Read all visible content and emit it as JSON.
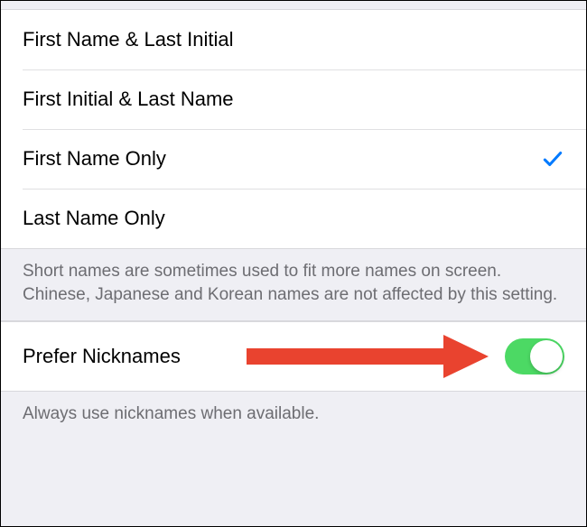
{
  "options": {
    "items": [
      {
        "label": "First Name & Last Initial",
        "selected": false
      },
      {
        "label": "First Initial & Last Name",
        "selected": false
      },
      {
        "label": "First Name Only",
        "selected": true
      },
      {
        "label": "Last Name Only",
        "selected": false
      }
    ],
    "footer": "Short names are sometimes used to fit more names on screen. Chinese, Japanese and Korean names are not affected by this setting."
  },
  "nicknames": {
    "label": "Prefer Nicknames",
    "enabled": true,
    "footer": "Always use nicknames when available."
  },
  "colors": {
    "accent": "#007aff",
    "toggle_on": "#4cd964",
    "annotation": "#e9432f"
  }
}
